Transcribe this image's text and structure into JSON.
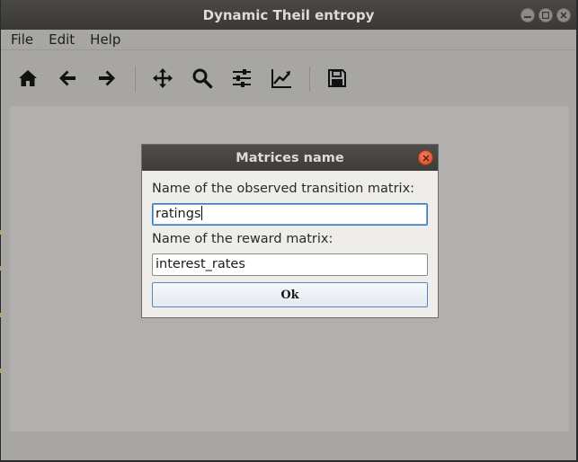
{
  "window": {
    "title": "Dynamic Theil entropy"
  },
  "menubar": {
    "items": [
      {
        "label": "File"
      },
      {
        "label": "Edit"
      },
      {
        "label": "Help"
      }
    ]
  },
  "toolbar": {
    "tools": [
      "home-icon",
      "back-arrow-icon",
      "forward-arrow-icon",
      "pan-icon",
      "zoom-icon",
      "subplots-config-icon",
      "edit-axes-icon",
      "save-icon"
    ]
  },
  "dialog": {
    "title": "Matrices name",
    "observed_label": "Name of the observed transition matrix:",
    "observed_value": "ratings",
    "reward_label": "Name of the reward matrix:",
    "reward_value": "interest_rates",
    "ok_label": "Ok"
  },
  "colors": {
    "titlebar": "#3a3935",
    "window_bg": "#a8a6a3",
    "canvas_bg": "#b1b0ae",
    "dialog_bg": "#efedea",
    "close_button": "#e05a34",
    "focus_border": "#3b78b8"
  }
}
